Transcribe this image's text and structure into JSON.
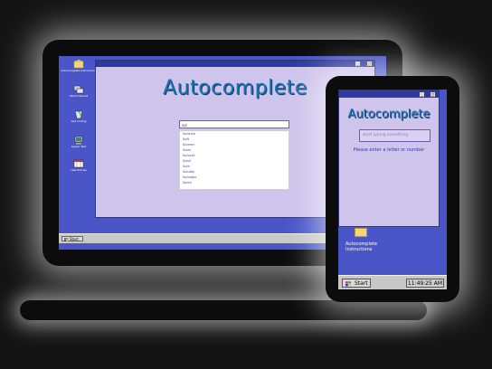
{
  "laptop": {
    "desktop_icons": [
      {
        "label": "Autocomplete Instructions",
        "icon": "folder-icon"
      },
      {
        "label": "Start Internet",
        "icon": "network-icon"
      },
      {
        "label": "Get Coding",
        "icon": "paint-icon"
      },
      {
        "label": "Speed Test",
        "icon": "computer-icon"
      },
      {
        "label": "Last Entries",
        "icon": "calendar-icon"
      }
    ],
    "window": {
      "heading": "Autocomplete",
      "input_value": "sol",
      "suggestions": [
        "Solstice",
        "Soft",
        "Solemn",
        "Solar",
        "Solvent",
        "Solid",
        "Sole",
        "Soluble",
        "Solvable",
        "Soleil"
      ]
    },
    "taskbar": {
      "start_label": "Start"
    }
  },
  "phone": {
    "window": {
      "heading": "Autocomplete",
      "input_placeholder": "start typing something",
      "hint": "Please enter a letter or number"
    },
    "desktop_icon_label": "Autocomplete Instructions",
    "taskbar": {
      "start_label": "Start",
      "clock": "11:49:25 AM"
    }
  },
  "colors": {
    "desktop": "#4a56c8",
    "window": "#cfc4ec",
    "titlebar": "#2e3aa0",
    "heading": "#1f6fb0"
  }
}
